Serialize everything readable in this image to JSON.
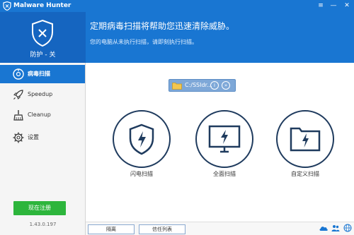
{
  "window": {
    "title": "Malware Hunter",
    "controls": [
      "≡",
      "—",
      "✕"
    ]
  },
  "header": {
    "protection_status": "防护 - 关",
    "message_main": "定期病毒扫描将帮助您迅速清除威胁。",
    "message_sub": "您的电脑从未执行扫描，请即刻执行扫描。"
  },
  "sidebar": {
    "items": [
      {
        "label": "病毒扫描",
        "icon": "scan-icon",
        "active": true
      },
      {
        "label": "Speedup",
        "icon": "rocket-icon",
        "active": false
      },
      {
        "label": "Cleanup",
        "icon": "broom-icon",
        "active": false
      },
      {
        "label": "设置",
        "icon": "gear-icon",
        "active": false
      }
    ],
    "register_label": "现在注册",
    "version": "1.43.0.197"
  },
  "main": {
    "scan_target": {
      "label": "C:/SSIdr...",
      "info": "i",
      "arrow": "»"
    },
    "scan_options": [
      {
        "label": "闪电扫描",
        "icon": "shield-bolt-icon"
      },
      {
        "label": "全面扫描",
        "icon": "monitor-bolt-icon"
      },
      {
        "label": "自定义扫描",
        "icon": "folder-bolt-icon"
      }
    ]
  },
  "footer": {
    "buttons": [
      "隔离",
      "信任列表"
    ],
    "icons": [
      "cloud-icon",
      "people-icon",
      "globe-icon"
    ]
  },
  "colors": {
    "primary": "#1976d2",
    "header_dark": "#1565c0",
    "register_green": "#2db53c",
    "icon_navy": "#1f3b5e"
  }
}
